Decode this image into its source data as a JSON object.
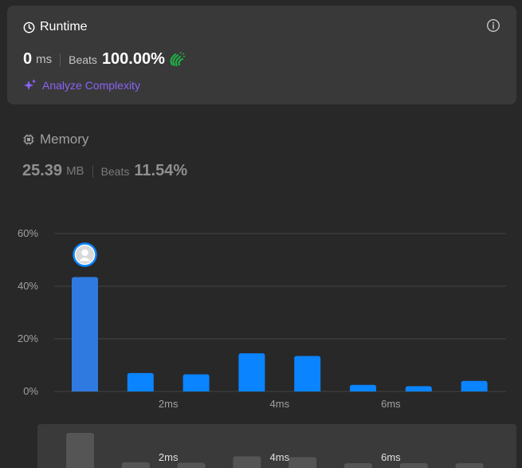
{
  "runtime": {
    "title": "Runtime",
    "value": "0",
    "unit": "ms",
    "beats_label": "Beats",
    "beats_value": "100.00%",
    "analyze_label": "Analyze Complexity"
  },
  "memory": {
    "title": "Memory",
    "value": "25.39",
    "unit": "MB",
    "beats_label": "Beats",
    "beats_value": "11.54%"
  },
  "colors": {
    "accent": "#0a84ff",
    "accent_hover": "#2f7ae0",
    "analyze": "#8a63f5",
    "clap": "#1fab46"
  },
  "icons": [
    "clock-icon",
    "info-icon",
    "sparkle-icon",
    "chip-icon",
    "clap-icon",
    "avatar-icon"
  ],
  "chart_data": {
    "type": "bar",
    "y_ticks": [
      "0%",
      "20%",
      "40%",
      "60%"
    ],
    "ylim": [
      0,
      60
    ],
    "x_tick_labels": [
      {
        "label": "2ms",
        "after_bar": 2
      },
      {
        "label": "4ms",
        "after_bar": 4
      },
      {
        "label": "6ms",
        "after_bar": 6
      }
    ],
    "values": [
      43.5,
      7,
      6.5,
      14.5,
      13.5,
      2.5,
      2,
      4
    ],
    "highlight_index": 0,
    "grid": true
  },
  "overview": {
    "values": [
      43.5,
      7,
      6.5,
      14.5,
      13.5,
      2.5,
      2,
      4
    ],
    "labels": [
      "2ms",
      "4ms",
      "6ms"
    ]
  }
}
